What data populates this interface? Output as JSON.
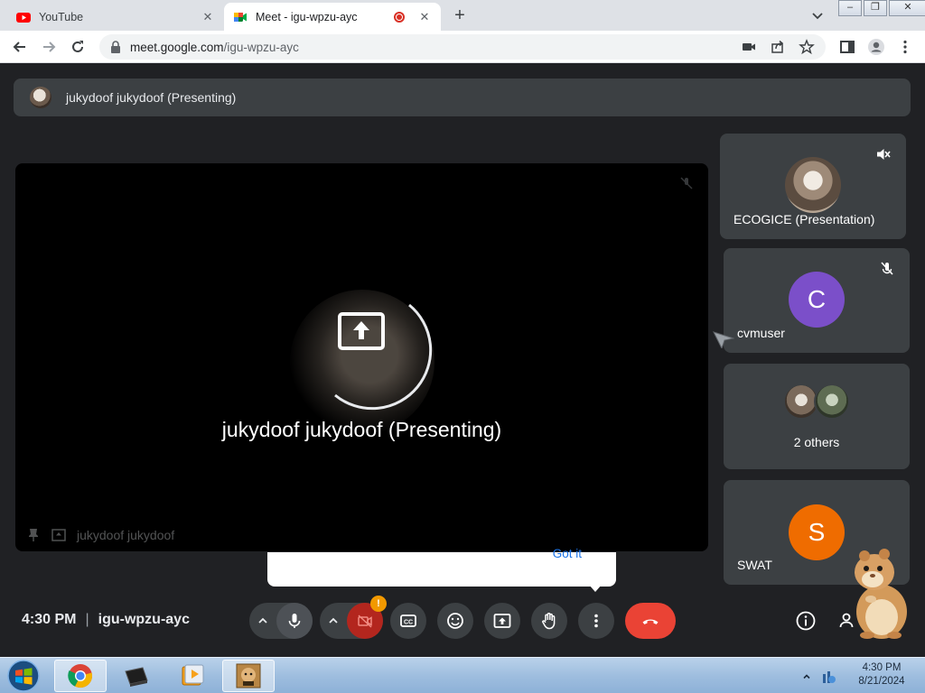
{
  "browser": {
    "tabs": [
      {
        "title": "YouTube",
        "active": false
      },
      {
        "title": "Meet - igu-wpzu-ayc",
        "active": true,
        "recording": true
      }
    ],
    "close_glyph": "✕",
    "new_tab_glyph": "+",
    "url": {
      "host": "meet.google.com",
      "path": "/igu-wpzu-ayc"
    },
    "window_buttons": [
      "–",
      "❐",
      "✕"
    ]
  },
  "meet": {
    "presenter_bar_text": "jukydoof jukydoof (Presenting)",
    "main_tile": {
      "label": "jukydoof jukydoof (Presenting)",
      "footer_name": "jukydoof jukydoof"
    },
    "participants": [
      {
        "name": "ECOGICE (Presentation)",
        "avatar": "photo",
        "muted": true,
        "mute_icon": "volume-off-icon"
      },
      {
        "name": "cvmuser",
        "avatar_letter": "C",
        "avatar_color": "#7b4fc9",
        "muted": true,
        "mute_icon": "mic-off-icon"
      },
      {
        "name": "2 others",
        "avatar": "group"
      },
      {
        "name": "SWAT",
        "avatar_letter": "S",
        "avatar_color": "#ef6c00"
      }
    ],
    "tooltip": {
      "action": "Got it"
    },
    "meeting_time": "4:30 PM",
    "meeting_code": "igu-wpzu-ayc",
    "camera_warning_badge": "!",
    "colors": {
      "end_call": "#ea4335",
      "control_bg": "#3c4043",
      "accent_link": "#1a73e8"
    }
  },
  "taskbar": {
    "time": "4:30 PM",
    "date": "8/21/2024"
  }
}
